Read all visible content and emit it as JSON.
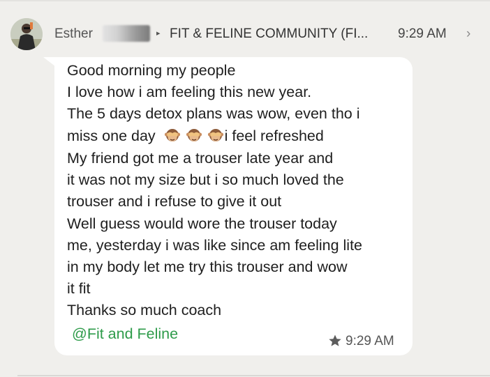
{
  "header": {
    "sender": "Esther",
    "group_name": "FIT & FELINE COMMUNITY (FI...",
    "time": "9:29 AM",
    "chevron": "›",
    "separator": "▸"
  },
  "message": {
    "lines": [
      "Good morning my people",
      "I love how i am feeling this new year.",
      "The 5 days detox plans was wow, even tho i",
      "miss one day",
      "My friend got me a trouser late year and",
      "it was not my size but i so much loved the",
      "trouser and i refuse to give it out",
      "Well guess would wore the trouser today",
      "me, yesterday i was like since am feeling lite",
      "in my body let me try this trouser and wow",
      "it fit",
      "Thanks so much coach"
    ],
    "line4_suffix": "i feel refreshed",
    "emoji_name": "see-no-evil-monkey-icon",
    "mention": "@Fit and Feline",
    "time": "9:29 AM",
    "starred": true
  },
  "colors": {
    "background": "#f0efec",
    "bubble": "#ffffff",
    "mention": "#2e9b4a"
  }
}
